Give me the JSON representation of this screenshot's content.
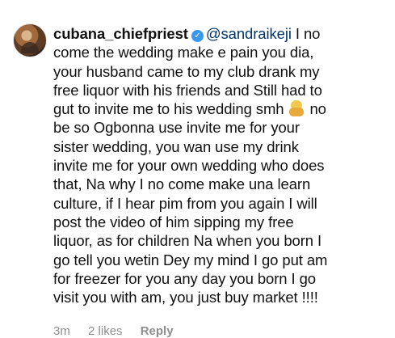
{
  "comment": {
    "username": "cubana_chiefpriest",
    "verified_icon": "verified-badge-icon",
    "mention": "@sandraikeji",
    "lines": [
      " I no",
      "come the wedding make e pain you dia,",
      "your husband came to my club drank my",
      "free liquor with his friends and Still had to",
      "gut to invite me to his wedding smh",
      "no",
      "be so Ogbonna use invite me for your",
      "sister wedding, you wan use my drink",
      "invite me for your own wedding who does",
      "that, Na why I no come make una learn",
      "culture, if I hear pim from you again I will",
      "post the video of him sipping my free",
      "liquor, as for children Na when you born I",
      "go tell you wetin Dey my mind I go put am",
      "for freezer for you any day you born I go",
      "visit you with am, you just buy market !!!!"
    ],
    "emoji": "facepalm-emoji-icon",
    "meta": {
      "time": "3m",
      "likes": "2 likes",
      "reply": "Reply"
    },
    "colors": {
      "text": "#111111",
      "mention": "#003569",
      "meta": "#8e8e8e",
      "verified": "#3897f0"
    }
  }
}
